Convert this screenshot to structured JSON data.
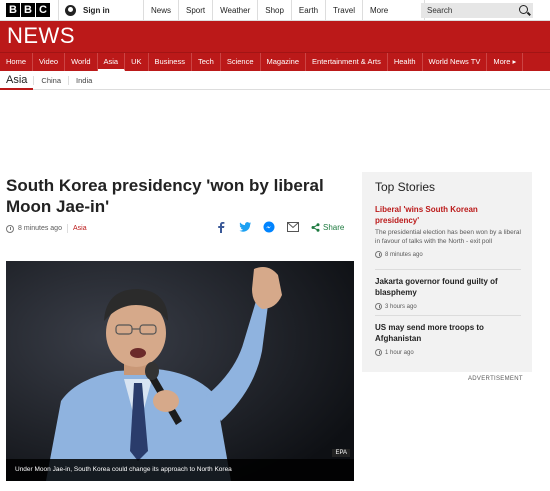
{
  "bbc_logo": [
    "B",
    "B",
    "C"
  ],
  "signin": {
    "label": "Sign in",
    "icon": "user-icon"
  },
  "topnav": [
    {
      "label": "News"
    },
    {
      "label": "Sport"
    },
    {
      "label": "Weather"
    },
    {
      "label": "Shop"
    },
    {
      "label": "Earth"
    },
    {
      "label": "Travel"
    },
    {
      "label": "More"
    }
  ],
  "search": {
    "placeholder": "Search",
    "icon": "search-icon"
  },
  "brand": {
    "title": "NEWS",
    "color": "#bb1919"
  },
  "rednav": [
    {
      "label": "Home"
    },
    {
      "label": "Video"
    },
    {
      "label": "World"
    },
    {
      "label": "Asia"
    },
    {
      "label": "UK"
    },
    {
      "label": "Business"
    },
    {
      "label": "Tech"
    },
    {
      "label": "Science"
    },
    {
      "label": "Magazine"
    },
    {
      "label": "Entertainment & Arts"
    },
    {
      "label": "Health"
    },
    {
      "label": "World News TV"
    },
    {
      "label": "More ▸"
    }
  ],
  "subnav": {
    "section": "Asia",
    "links": [
      "China",
      "India"
    ]
  },
  "article": {
    "headline": "South Korea presidency 'won by liberal Moon Jae-in'",
    "time": "8 minutes ago",
    "tag": "Asia",
    "share_label": "Share",
    "image_credit": "EPA",
    "caption": "Under Moon Jae-in, South Korea could change its approach to North Korea"
  },
  "top_stories": {
    "heading": "Top Stories",
    "items": [
      {
        "title": "Liberal 'wins South Korean presidency'",
        "summary": "The presidential election has been won by a liberal in favour of talks with the North - exit poll",
        "time": "8 minutes ago"
      },
      {
        "title": "Jakarta governor found guilty of blasphemy",
        "time": "3 hours ago"
      },
      {
        "title": "US may send more troops to Afghanistan",
        "time": "1 hour ago"
      }
    ]
  },
  "advertisement_label": "ADVERTISEMENT"
}
